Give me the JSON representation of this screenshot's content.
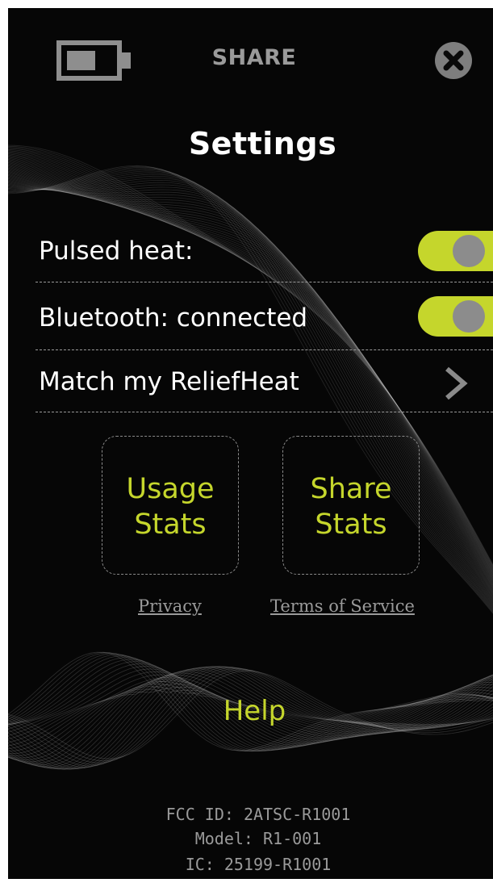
{
  "topbar": {
    "battery_icon": "battery-icon",
    "share_label": "SHARE",
    "close_icon": "close-icon"
  },
  "title": "Settings",
  "settings": {
    "pulsed_heat": {
      "label": "Pulsed heat:",
      "enabled": true
    },
    "bluetooth": {
      "label": "Bluetooth: connected",
      "enabled": true
    },
    "match": {
      "label": "Match my ReliefHeat",
      "icon": "chevron-right-icon"
    }
  },
  "cards": {
    "usage": {
      "line1": "Usage",
      "line2": "Stats"
    },
    "share": {
      "line1": "Share",
      "line2": "Stats"
    }
  },
  "links": {
    "privacy": "Privacy",
    "terms": "Terms of Service"
  },
  "help": "Help",
  "footer": {
    "fcc": "FCC ID: 2ATSC-R1001",
    "model": "Model: R1-001",
    "ic": "IC: 25199-R1001"
  },
  "colors": {
    "background": "#060606",
    "accent": "#c5d62c",
    "muted": "#9a9a9a",
    "knob": "#8c8c8c"
  }
}
